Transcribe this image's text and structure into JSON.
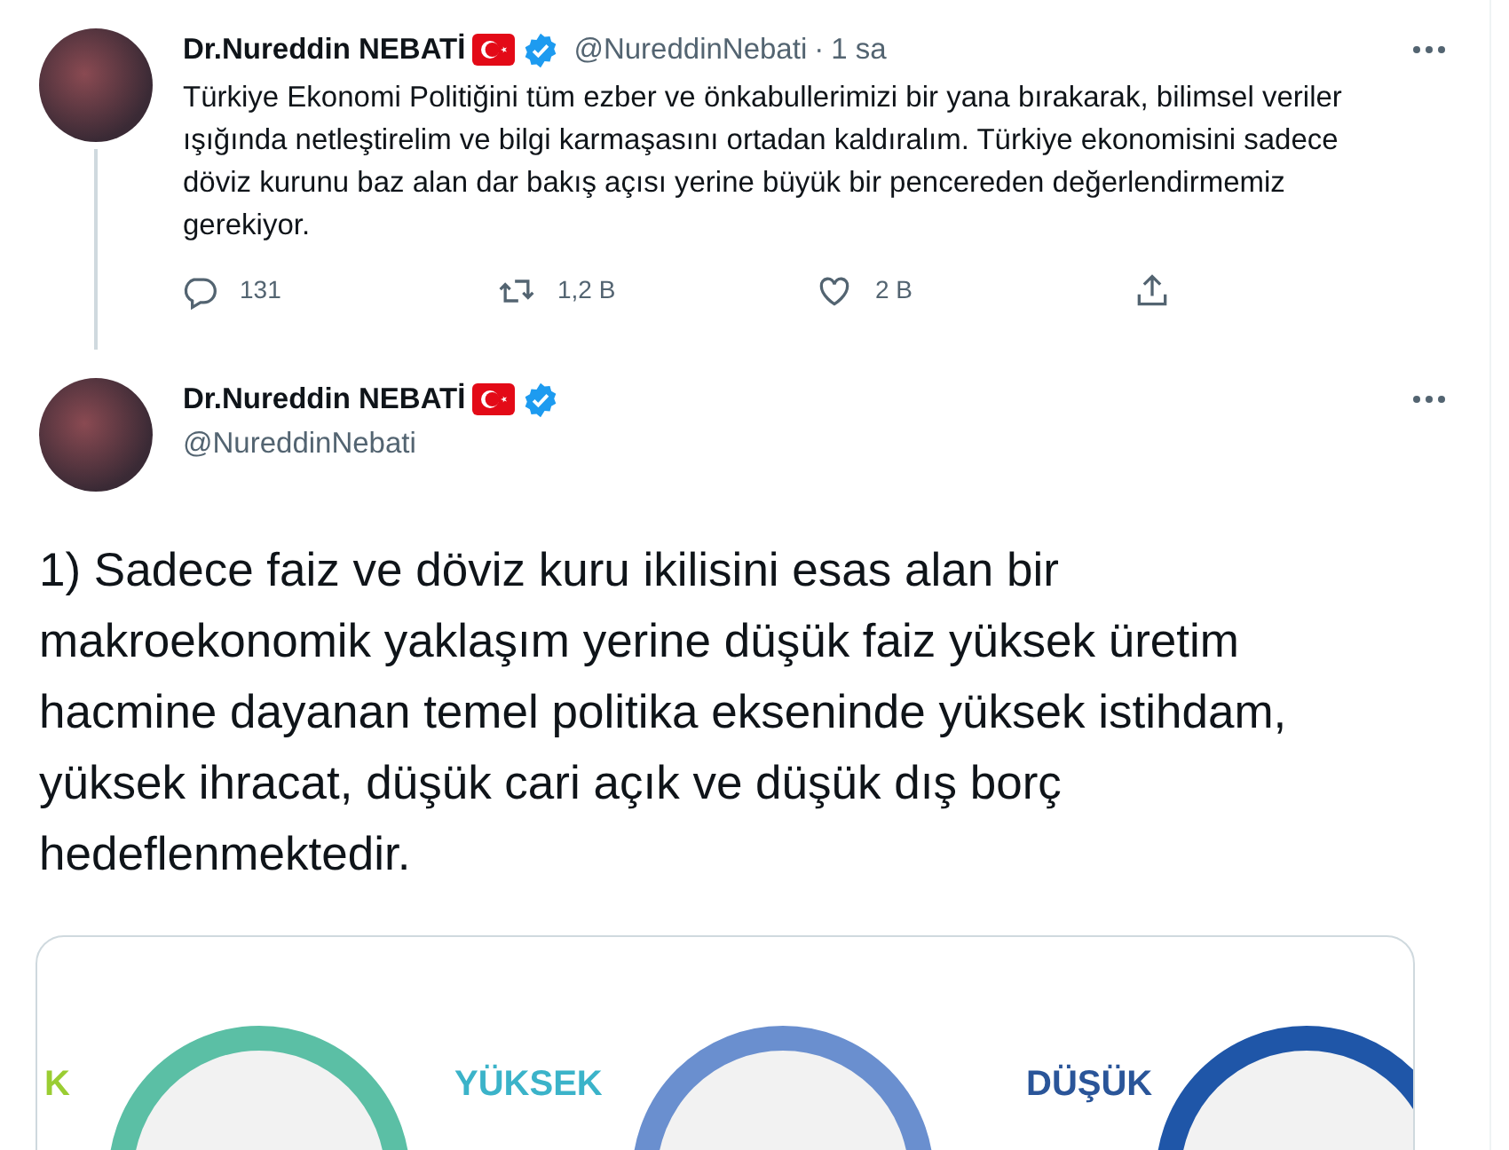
{
  "tweets": [
    {
      "kind": "reply_parent",
      "name": "Dr.Nureddin NEBATİ",
      "verified": true,
      "handle": "@NureddinNebati",
      "separator": "·",
      "time": "1 sa",
      "text": "Türkiye Ekonomi Politiğini tüm ezber ve önkabullerimizi bir yana bırakarak, bilimsel veriler ışığında netleştirelim ve bilgi karmaşasını ortadan kaldıralım. Türkiye ekonomisini sadece döviz kurunu baz alan dar bakış açısı yerine büyük bir pencereden değerlendirmemiz gerekiyor.",
      "actions": [
        {
          "kind": "reply",
          "count": "131"
        },
        {
          "kind": "retweet",
          "count": "1,2 B"
        },
        {
          "kind": "like",
          "count": "2 B"
        },
        {
          "kind": "share"
        }
      ]
    },
    {
      "kind": "focused",
      "name": "Dr.Nureddin NEBATİ",
      "verified": true,
      "handle": "@NureddinNebati",
      "text": "1) Sadece faiz ve döviz kuru ikilisini esas alan bir makroekonomik yaklaşım yerine düşük faiz yüksek üretim hacmine dayanan temel politika ekseninde yüksek istihdam, yüksek ihracat, düşük cari açık ve düşük dış borç hedeflenmektedir.",
      "media": {
        "labels": [
          {
            "text": "K",
            "color": "#9acd32"
          },
          {
            "text": "YÜKSEK",
            "color": "#3bb3c9"
          },
          {
            "text": "DÜŞÜK",
            "color": "#2a5599"
          }
        ]
      }
    }
  ]
}
